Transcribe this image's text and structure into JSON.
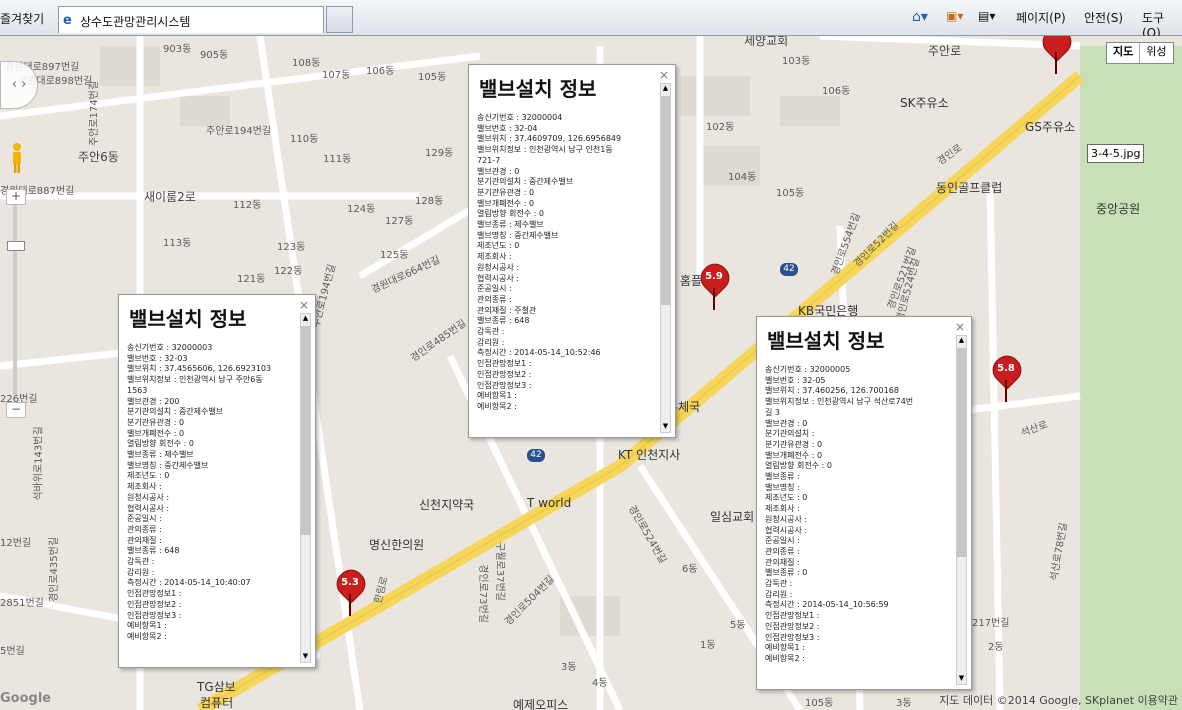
{
  "ie": {
    "favorites": "즐겨찾기",
    "tab_title": "상수도관망관리시스템",
    "menu": [
      "페이지(P)",
      "안전(S)",
      "도구(O)"
    ]
  },
  "map": {
    "type_buttons": [
      "지도",
      "위성"
    ],
    "file_tag": "3-4-5.jpg",
    "footer": "지도 데이터 ©2014 Google, SKplanet",
    "footer_terms": "이용약관",
    "labels": [
      "903동",
      "905동",
      "경원대로897번길",
      "경원대로898번길",
      "108동",
      "107동",
      "106동",
      "105동",
      "주안로194번길",
      "110동",
      "111동",
      "129동",
      "주안6동",
      "주안로174번길",
      "새이룸2로",
      "112동",
      "124동",
      "127동",
      "128동",
      "경원대로887번길",
      "113동",
      "123동",
      "125동",
      "121동",
      "122동",
      "경원대로664번길",
      "주안로194번길",
      "경인로485번길",
      "세양교회",
      "주안로",
      "103동",
      "106동",
      "102동",
      "104동",
      "105동",
      "SK주유소",
      "GS주유소",
      "동인골프클럽",
      "중앙공원",
      "석산로",
      "KB국민은행",
      "천우체국",
      "KT 인천지사",
      "신천지약국",
      "T world",
      "명신한의원",
      "일심교회",
      "경인로504번길",
      "경인로524번길",
      "경인로554번길",
      "경인로521번길",
      "경인로524번길",
      "석산로78번길",
      "217번길",
      "5동",
      "3동",
      "4동",
      "6동",
      "1동",
      "2동",
      "105동",
      "3동",
      "석바위로143번길",
      "226번길",
      "12번길",
      "경인로435번길",
      "2851번길",
      "5번길",
      "TG삼보",
      "컴퓨터",
      "예제오피스",
      "홈플러스",
      "경인로",
      "한림로",
      "구월로37번길",
      "경인로52번길",
      "경인로73번길"
    ],
    "route_shield": "42",
    "markers": [
      "5.9",
      "5.8",
      "5.3"
    ]
  },
  "infowindows": [
    {
      "title": "밸브설치 정보",
      "lines": [
        "송신기번호 : 32000004",
        "밸브번호 : 32-04",
        "밸브위치 : 37.4609709, 126.6956849",
        "밸브위치정보 : 인천광역시 남구 인천1동",
        "721-7",
        "밸브관경 : 0",
        "분기관의설치 : 중간제수밸브",
        "분기관유관경 : 0",
        "밸브개폐전수 : 0",
        "열림방향 회전수 : 0",
        "밸브종류 : 제수밸브",
        "밸브명칭 : 중간제수밸브",
        "제조년도 : 0",
        "제조회사 :",
        "원청시공사 :",
        "협력시공사 :",
        "준공일시 :",
        "관의종류 :",
        "관의재질 : 주철관",
        "밸브종류 : 648",
        "감독관 :",
        "감리원 :",
        "측정시간 : 2014-05-14_10:52:46",
        "인접관망정보1 :",
        "인접관망정보2 :",
        "인접관망정보3 :",
        "예비항목1 :",
        "예비항목2 :"
      ]
    },
    {
      "title": "밸브설치 정보",
      "lines": [
        "송신기번호 : 32000003",
        "밸브번호 : 32-03",
        "밸브위치 : 37.4565606, 126.6923103",
        "밸브위치정보 : 인천광역시 남구 주안6동",
        "1563",
        "밸브관경 : 200",
        "분기관의설치 : 중간제수밸브",
        "분기관유관경 : 0",
        "밸브개폐전수 : 0",
        "열림방향 회전수 : 0",
        "밸브종류 : 제수밸브",
        "밸브명칭 : 중간제수밸브",
        "제조년도 : 0",
        "제조회사 :",
        "원청시공사 :",
        "협력시공사 :",
        "준공일시 :",
        "관의종류 :",
        "관의재질 :",
        "밸브종류 : 648",
        "감독관 :",
        "감리원 :",
        "측정시간 : 2014-05-14_10:40:07",
        "인접관망정보1 :",
        "인접관망정보2 :",
        "인접관망정보3 :",
        "예비항목1 :",
        "예비항목2 :"
      ]
    },
    {
      "title": "밸브설치 정보",
      "lines": [
        "송신기번호 : 32000005",
        "밸브번호 : 32-05",
        "밸브위치 : 37.460256, 126.700168",
        "밸브위치정보 : 인천광역시 남구 석산로74번",
        "길 3",
        "밸브관경 : 0",
        "분기관의설치 :",
        "분기관유관경 : 0",
        "밸브개폐전수 : 0",
        "열림방향 회전수 : 0",
        "밸브종류 :",
        "밸브명칭 :",
        "제조년도 : 0",
        "제조회사 :",
        "원청시공사 :",
        "협력시공사 :",
        "준공일시 :",
        "관의종류 :",
        "관의재질 :",
        "밸브종류 : 0",
        "감독관 :",
        "감리원 :",
        "측정시간 : 2014-05-14_10:56:59",
        "인접관망정보1 :",
        "인접관망정보2 :",
        "인접관망정보3 :",
        "예비항목1 :",
        "예비항목2 :"
      ]
    }
  ]
}
